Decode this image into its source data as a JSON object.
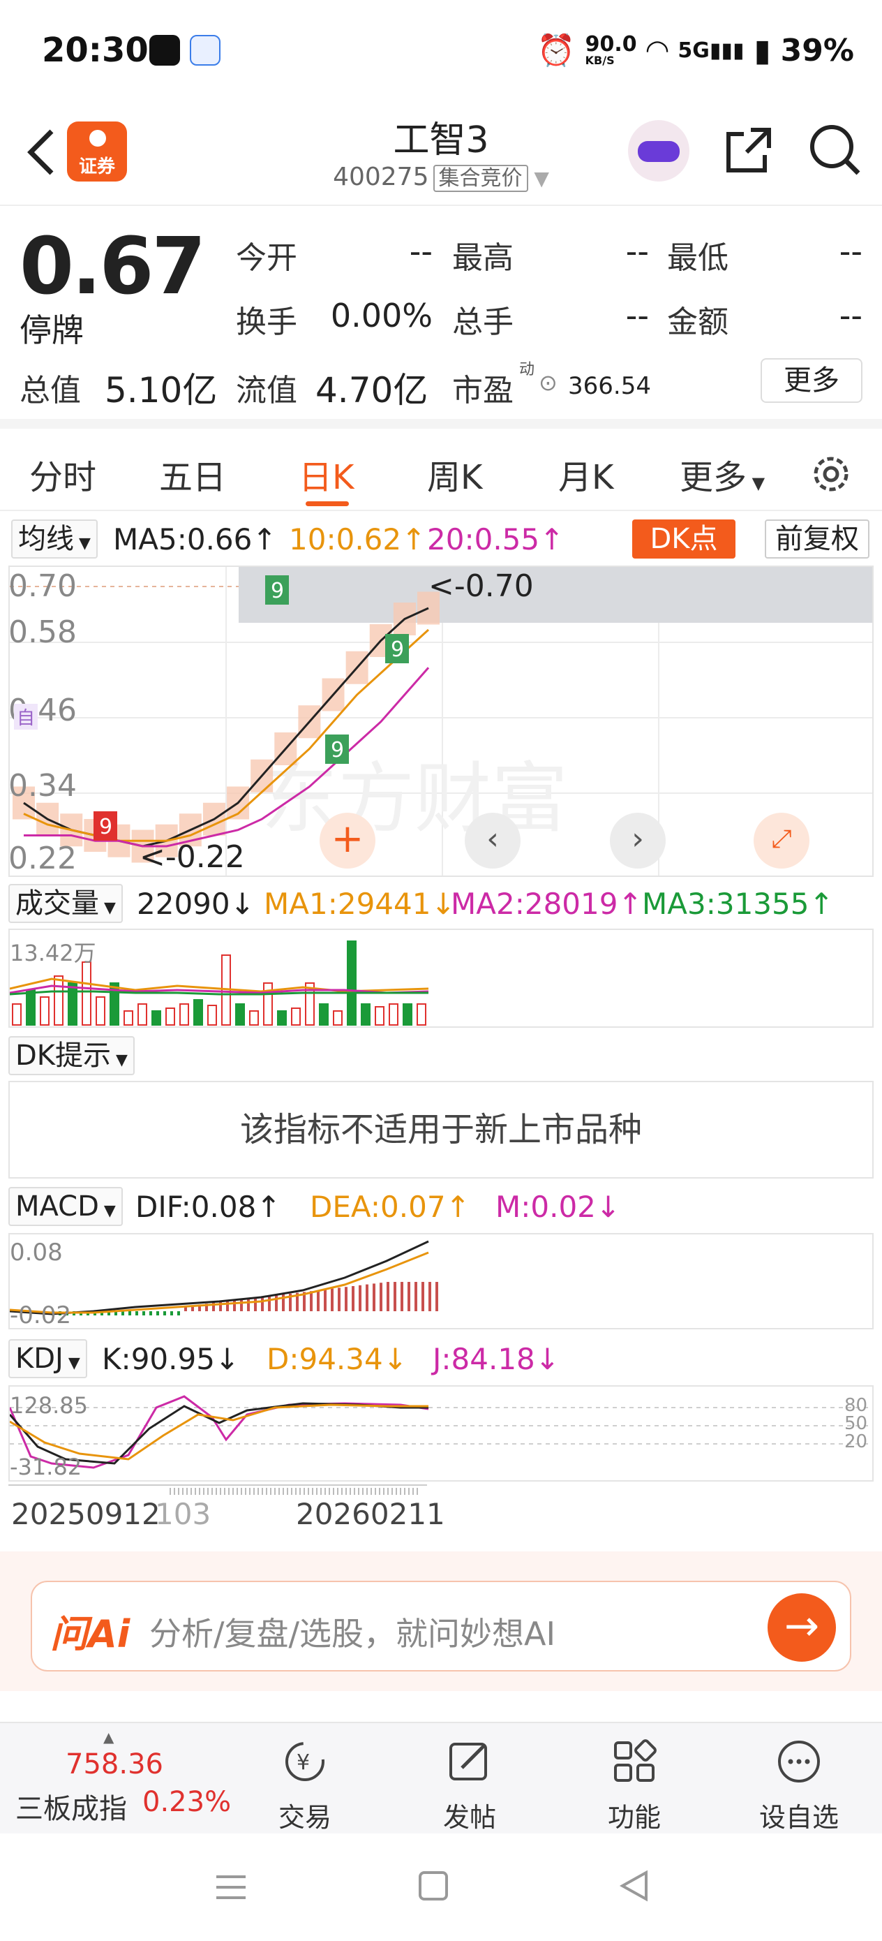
{
  "status_bar": {
    "time": "20:30",
    "net_speed": "90.0",
    "net_unit": "KB/S",
    "signal": "5G",
    "battery": "39%"
  },
  "header": {
    "logo_text": "证券",
    "title": "工智3",
    "code": "400275",
    "session_tag": "集合竞价"
  },
  "quote": {
    "price": "0.67",
    "status": "停牌",
    "rows": [
      {
        "l1": "今开",
        "v1": "--",
        "l2": "最高",
        "v2": "--",
        "l3": "最低",
        "v3": "--"
      },
      {
        "l1": "换手",
        "v1": "0.00%",
        "l2": "总手",
        "v2": "--",
        "l3": "金额",
        "v3": "--"
      }
    ],
    "total_value_label": "总值",
    "total_value": "5.10亿",
    "float_value_label": "流值",
    "float_value": "4.70亿",
    "pe_label": "市盈",
    "pe_sup": "动",
    "pe_value": "366.54",
    "more_label": "更多"
  },
  "tabs": [
    "分时",
    "五日",
    "日K",
    "周K",
    "月K",
    "更多"
  ],
  "active_tab": 2,
  "ma_row": {
    "selector": "均线",
    "ma5": "MA5:0.66↑",
    "ma10": "10:0.62↑",
    "ma20": "20:0.55↑",
    "dk_label": "DK点",
    "adjust_label": "前复权"
  },
  "kline": {
    "y_labels": [
      "0.70",
      "0.58",
      "0.46",
      "0.34",
      "0.22"
    ],
    "max_label": "<-0.70",
    "min_label": "<-0.22",
    "watermark": "东方财富",
    "side_tag": "自"
  },
  "volume": {
    "selector": "成交量",
    "value": "22090↓",
    "ma1": "MA1:29441↓",
    "ma2": "MA2:28019↑",
    "ma3": "MA3:31355↑",
    "max_label": "13.42万"
  },
  "dk": {
    "selector": "DK提示",
    "notice": "该指标不适用于新上市品种"
  },
  "macd": {
    "selector": "MACD",
    "dif": "DIF:0.08↑",
    "dea": "DEA:0.07↑",
    "m": "M:0.02↓",
    "top_label": "0.08",
    "bottom_label": "-0.02"
  },
  "kdj": {
    "selector": "KDJ",
    "k": "K:90.95↓",
    "d": "D:94.34↓",
    "j": "J:84.18↓",
    "top_label": "128.85",
    "bottom_label": "-31.82",
    "levels": [
      "80",
      "50",
      "20"
    ]
  },
  "dates": [
    "20250912",
    "103",
    "20260211"
  ],
  "ai": {
    "logo": "问Ai",
    "placeholder": "分析/复盘/选股，就问妙想AI"
  },
  "bottom_nav": {
    "index_value": "758.36",
    "index_name": "三板成指",
    "index_pct": "0.23%",
    "items": [
      "交易",
      "发帖",
      "功能",
      "设自选"
    ]
  },
  "colors": {
    "accent": "#f35b1c",
    "rise": "#e0312e",
    "fall": "#1a9a38",
    "ma10": "#e8940c",
    "ma20": "#cc2aa6"
  },
  "chart_data": {
    "type": "line",
    "title": "",
    "series": [
      {
        "name": "MA5",
        "values": [
          0.3,
          0.27,
          0.25,
          0.24,
          0.23,
          0.22,
          0.23,
          0.25,
          0.27,
          0.3,
          0.35,
          0.4,
          0.45,
          0.5,
          0.55,
          0.6,
          0.64,
          0.66
        ]
      },
      {
        "name": "10",
        "values": [
          0.28,
          0.26,
          0.25,
          0.24,
          0.23,
          0.23,
          0.23,
          0.24,
          0.26,
          0.28,
          0.32,
          0.36,
          0.4,
          0.45,
          0.5,
          0.54,
          0.58,
          0.62
        ]
      },
      {
        "name": "20",
        "values": [
          0.24,
          0.24,
          0.24,
          0.23,
          0.23,
          0.22,
          0.22,
          0.23,
          0.24,
          0.25,
          0.27,
          0.3,
          0.33,
          0.37,
          0.41,
          0.45,
          0.5,
          0.55
        ]
      }
    ],
    "ylim": [
      0.22,
      0.7
    ]
  }
}
